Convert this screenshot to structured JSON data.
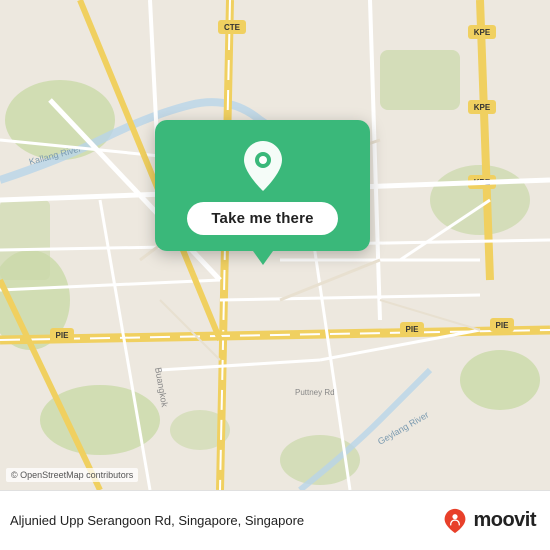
{
  "map": {
    "osm_credit": "© OpenStreetMap contributors"
  },
  "popup": {
    "button_label": "Take me there",
    "pin_icon": "location-pin"
  },
  "bottom_bar": {
    "address": "Aljunied Upp Serangoon Rd, Singapore, Singapore",
    "logo_text": "moovit"
  }
}
